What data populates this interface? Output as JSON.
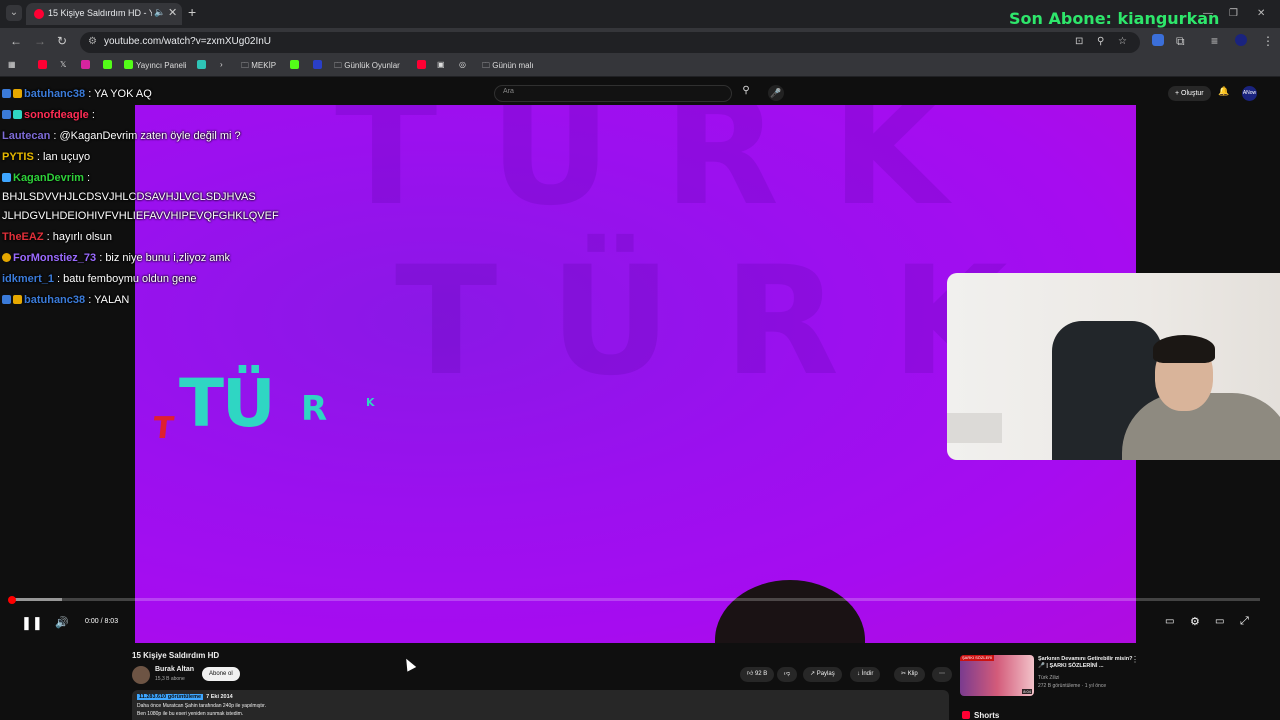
{
  "browser": {
    "tab_title": "15 Kişiye Saldırdım HD - Yo",
    "tab_audio_icon": "speaker-icon",
    "url": "youtube.com/watch?v=zxmXUg02InU",
    "bookmarks": [
      "Yayıncı Paneli",
      "MEKİP",
      "Günlük Oyunlar",
      "Günün malı"
    ]
  },
  "overlay": {
    "last_subscriber": "Son Abone: kiangurkan"
  },
  "youtube": {
    "search_placeholder": "Ara",
    "create_label": "Oluştur",
    "avatar_text": "ANow"
  },
  "chat": [
    {
      "user": "batuhanc38",
      "msg": ": YA YOK AQ",
      "color": "#3b7bd9"
    },
    {
      "user": "sonofdeagle",
      "msg": ":",
      "color": "#ff2d55"
    },
    {
      "user": "Lautecan",
      "msg": ": @KaganDevrim zaten öyle değil mi ?",
      "color": "#7d6bd6"
    },
    {
      "user": "PYTIS",
      "msg": ": lan uçuyo",
      "color": "#e6b800"
    },
    {
      "user": "KaganDevrim",
      "msg": ":",
      "color": "#2fd03a"
    },
    {
      "user": "",
      "msg": "BHJLSDVVHJLCDSVJHLCDSAVHJLVCLSDJHVAS",
      "color": "#fff"
    },
    {
      "user": "",
      "msg": "JLHDGVLHDEIOHIVFVHLIEFAVVHIPEVQFGHKLQVEF",
      "color": "#fff"
    },
    {
      "user": "TheEAZ",
      "msg": ": hayırlı olsun",
      "color": "#e0303a"
    },
    {
      "user": "ForMonstiez_73",
      "msg": ": biz niye bunu i,zliyoz amk",
      "color": "#9b6bff"
    },
    {
      "user": "idkmert_1",
      "msg": ": batu femboymu oldun gene",
      "color": "#3b7bd9"
    },
    {
      "user": "batuhanc38",
      "msg": ": YALAN",
      "color": "#3b7bd9"
    }
  ],
  "video": {
    "logo_t": "T",
    "logo_tu": "TÜ",
    "logo_r": "R",
    "logo_k": "K",
    "time": "0:00 / 8:03",
    "progress_fraction": 0.0
  },
  "below": {
    "title": "15 Kişiye Saldırdım HD",
    "channel": "Burak Altan",
    "subs": "15,3 B abone",
    "subscribe": "Abone ol",
    "like": "92 B",
    "share": "Paylaş",
    "download": "İndir",
    "clip": "Klip",
    "views": "11.283.610 görüntüleme",
    "date": "7 Eki 2014",
    "desc1": "Daha önce Muratcan Şahin tarafından 240p ile yapılmıştır.",
    "desc2": "Ben 1080p ile bu eseri yeniden sunmak istedim."
  },
  "recommendation": {
    "badge": "ŞARKI SÖZLERİ",
    "title": "Şarkının Devamını Getirebilir misin? 🎤 | ŞARKI SÖZLERİNİ ...",
    "channel": "Türk Zilizi",
    "meta": "272 B görüntüleme · 1 yıl önce",
    "duration": "8:04"
  },
  "shorts_label": "Shorts"
}
